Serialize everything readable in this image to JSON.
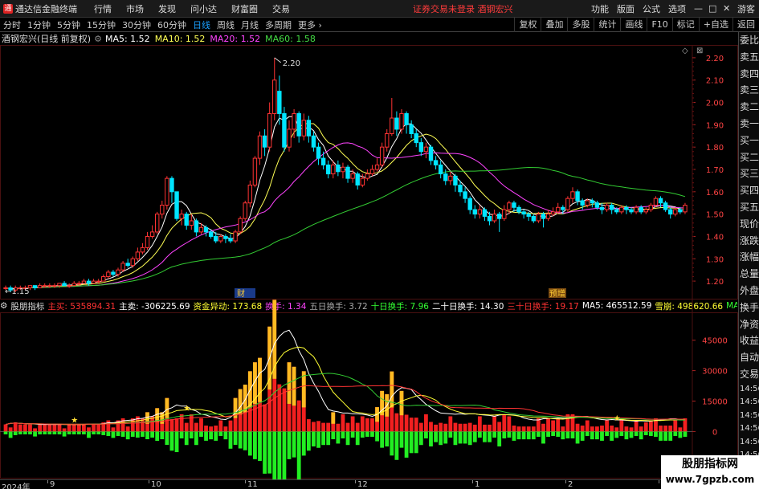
{
  "app": {
    "title": "通达信金融终端"
  },
  "menu": [
    "行情",
    "市场",
    "发现",
    "问小达",
    "财富圈",
    "交易"
  ],
  "notice": "证券交易未登录  酒钢宏兴",
  "right_menu": [
    "功能",
    "版面",
    "公式",
    "选项",
    "游客"
  ],
  "periods": [
    "分时",
    "1分钟",
    "5分钟",
    "15分钟",
    "30分钟",
    "60分钟",
    "日线",
    "周线",
    "月线",
    "多周期",
    "更多"
  ],
  "active_period": "日线",
  "toolbar_right": [
    "复权",
    "叠加",
    "多股",
    "统计",
    "画线",
    "F10",
    "标记",
    "+自选",
    "返回"
  ],
  "info": {
    "stock": "酒钢宏兴(日线 前复权)",
    "ma5": "MA5: 1.52",
    "ma10": "MA10: 1.52",
    "ma20": "MA20: 1.52",
    "ma60": "MA60: 1.58"
  },
  "right_panel": [
    "委比",
    "卖五",
    "卖四",
    "卖三",
    "卖二",
    "卖一",
    "买一",
    "买二",
    "买三",
    "买四",
    "买五",
    "现价",
    "涨跌",
    "涨幅",
    "总量",
    "外盘",
    "换手",
    "净资",
    "收益"
  ],
  "right_panel_lower": [
    "自动",
    "交易",
    "14:56",
    "14:56",
    "14:56",
    "14:56",
    "14:56",
    "14:56",
    "14:56",
    "14:56",
    "14:56"
  ],
  "indicator": {
    "name": "股朋指标",
    "zhumai": "主买: 535894.31",
    "zhumai2": "主卖: -306225.69",
    "zijin": "资金异动: 173.68",
    "huanshou": "换手: 1.34",
    "wuri": "五日换手: 3.72",
    "shiri": "十日换手: 7.96",
    "ershi": "二十日换手: 14.30",
    "sanshi": "三十日换手: 19.17",
    "ma5": "MA5: 465512.59",
    "xuebeng": "雪崩: 498620.66",
    "ma21": "MA21: 447254.53"
  },
  "price_axis": [
    "2.20",
    "2.10",
    "2.00",
    "1.90",
    "1.80",
    "1.70",
    "1.60",
    "1.50",
    "1.40",
    "1.30",
    "1.20"
  ],
  "vol_axis": [
    "45000",
    "30000",
    "15000",
    "0",
    "-15000"
  ],
  "annotations": {
    "high": "2.20",
    "low": "1.15",
    "event1": "财",
    "event2": "预增"
  },
  "dates": [
    "2024年",
    "9",
    "10",
    "11",
    "12",
    "1",
    "2",
    "3"
  ],
  "watermark": {
    "line1": "股朋指标网",
    "line2": "www.7gpzb.com"
  },
  "chart_data": {
    "type": "candlestick",
    "price_range": [
      1.15,
      2.25
    ],
    "candles": [
      [
        1.17,
        1.17,
        1.18,
        1.16
      ],
      [
        1.17,
        1.16,
        1.18,
        1.15
      ],
      [
        1.16,
        1.17,
        1.18,
        1.15
      ],
      [
        1.17,
        1.17,
        1.18,
        1.16
      ],
      [
        1.17,
        1.17,
        1.18,
        1.16
      ],
      [
        1.17,
        1.18,
        1.18,
        1.16
      ],
      [
        1.18,
        1.17,
        1.18,
        1.16
      ],
      [
        1.17,
        1.18,
        1.19,
        1.17
      ],
      [
        1.18,
        1.18,
        1.19,
        1.17
      ],
      [
        1.18,
        1.18,
        1.19,
        1.17
      ],
      [
        1.18,
        1.18,
        1.19,
        1.17
      ],
      [
        1.18,
        1.19,
        1.19,
        1.17
      ],
      [
        1.19,
        1.18,
        1.2,
        1.18
      ],
      [
        1.18,
        1.18,
        1.19,
        1.17
      ],
      [
        1.18,
        1.19,
        1.2,
        1.18
      ],
      [
        1.19,
        1.19,
        1.2,
        1.18
      ],
      [
        1.19,
        1.2,
        1.21,
        1.19
      ],
      [
        1.2,
        1.19,
        1.21,
        1.18
      ],
      [
        1.19,
        1.2,
        1.21,
        1.19
      ],
      [
        1.2,
        1.2,
        1.21,
        1.19
      ],
      [
        1.2,
        1.22,
        1.23,
        1.2
      ],
      [
        1.22,
        1.24,
        1.25,
        1.21
      ],
      [
        1.24,
        1.23,
        1.25,
        1.22
      ],
      [
        1.23,
        1.25,
        1.26,
        1.22
      ],
      [
        1.25,
        1.28,
        1.29,
        1.24
      ],
      [
        1.28,
        1.27,
        1.3,
        1.26
      ],
      [
        1.27,
        1.3,
        1.31,
        1.26
      ],
      [
        1.3,
        1.33,
        1.35,
        1.29
      ],
      [
        1.33,
        1.35,
        1.37,
        1.32
      ],
      [
        1.35,
        1.4,
        1.42,
        1.34
      ],
      [
        1.4,
        1.42,
        1.45,
        1.39
      ],
      [
        1.42,
        1.5,
        1.51,
        1.41
      ],
      [
        1.5,
        1.54,
        1.56,
        1.48
      ],
      [
        1.54,
        1.66,
        1.67,
        1.52
      ],
      [
        1.66,
        1.6,
        1.67,
        1.55
      ],
      [
        1.6,
        1.48,
        1.6,
        1.47
      ],
      [
        1.48,
        1.5,
        1.52,
        1.45
      ],
      [
        1.5,
        1.45,
        1.51,
        1.43
      ],
      [
        1.45,
        1.47,
        1.5,
        1.43
      ],
      [
        1.47,
        1.42,
        1.48,
        1.4
      ],
      [
        1.42,
        1.44,
        1.46,
        1.41
      ],
      [
        1.44,
        1.42,
        1.45,
        1.4
      ],
      [
        1.42,
        1.4,
        1.43,
        1.39
      ],
      [
        1.4,
        1.38,
        1.42,
        1.37
      ],
      [
        1.38,
        1.4,
        1.41,
        1.37
      ],
      [
        1.4,
        1.39,
        1.41,
        1.37
      ],
      [
        1.39,
        1.38,
        1.41,
        1.37
      ],
      [
        1.38,
        1.42,
        1.43,
        1.37
      ],
      [
        1.42,
        1.48,
        1.49,
        1.41
      ],
      [
        1.48,
        1.55,
        1.56,
        1.47
      ],
      [
        1.55,
        1.63,
        1.65,
        1.53
      ],
      [
        1.63,
        1.75,
        1.76,
        1.62
      ],
      [
        1.75,
        1.85,
        1.87,
        1.72
      ],
      [
        1.85,
        1.8,
        1.88,
        1.76
      ],
      [
        1.8,
        1.95,
        2.0,
        1.78
      ],
      [
        1.95,
        2.1,
        2.2,
        1.92
      ],
      [
        2.05,
        1.95,
        2.12,
        1.9
      ],
      [
        1.95,
        1.8,
        1.98,
        1.78
      ],
      [
        1.8,
        1.88,
        1.92,
        1.78
      ],
      [
        1.88,
        1.95,
        1.97,
        1.84
      ],
      [
        1.95,
        1.85,
        1.96,
        1.82
      ],
      [
        1.85,
        1.92,
        1.95,
        1.83
      ],
      [
        1.92,
        1.85,
        1.94,
        1.82
      ],
      [
        1.85,
        1.8,
        1.87,
        1.78
      ],
      [
        1.8,
        1.75,
        1.82,
        1.72
      ],
      [
        1.75,
        1.72,
        1.78,
        1.7
      ],
      [
        1.72,
        1.68,
        1.74,
        1.66
      ],
      [
        1.68,
        1.72,
        1.74,
        1.66
      ],
      [
        1.72,
        1.69,
        1.74,
        1.67
      ],
      [
        1.69,
        1.71,
        1.73,
        1.66
      ],
      [
        1.71,
        1.66,
        1.72,
        1.64
      ],
      [
        1.66,
        1.68,
        1.7,
        1.64
      ],
      [
        1.68,
        1.63,
        1.69,
        1.61
      ],
      [
        1.63,
        1.66,
        1.68,
        1.62
      ],
      [
        1.66,
        1.68,
        1.7,
        1.65
      ],
      [
        1.68,
        1.7,
        1.72,
        1.67
      ],
      [
        1.7,
        1.72,
        1.75,
        1.69
      ],
      [
        1.72,
        1.8,
        1.82,
        1.71
      ],
      [
        1.8,
        1.86,
        1.88,
        1.78
      ],
      [
        1.86,
        1.93,
        2.02,
        1.85
      ],
      [
        1.93,
        1.88,
        1.96,
        1.85
      ],
      [
        1.88,
        1.95,
        1.97,
        1.86
      ],
      [
        1.95,
        1.9,
        1.96,
        1.86
      ],
      [
        1.9,
        1.86,
        1.92,
        1.84
      ],
      [
        1.86,
        1.82,
        1.88,
        1.8
      ],
      [
        1.82,
        1.78,
        1.84,
        1.76
      ],
      [
        1.78,
        1.8,
        1.82,
        1.75
      ],
      [
        1.8,
        1.74,
        1.81,
        1.72
      ],
      [
        1.74,
        1.72,
        1.76,
        1.7
      ],
      [
        1.72,
        1.68,
        1.74,
        1.66
      ],
      [
        1.68,
        1.65,
        1.7,
        1.63
      ],
      [
        1.65,
        1.67,
        1.69,
        1.63
      ],
      [
        1.67,
        1.63,
        1.68,
        1.6
      ],
      [
        1.63,
        1.6,
        1.65,
        1.58
      ],
      [
        1.6,
        1.57,
        1.62,
        1.55
      ],
      [
        1.57,
        1.52,
        1.58,
        1.5
      ],
      [
        1.52,
        1.5,
        1.54,
        1.48
      ],
      [
        1.5,
        1.52,
        1.54,
        1.48
      ],
      [
        1.52,
        1.49,
        1.53,
        1.47
      ],
      [
        1.49,
        1.47,
        1.51,
        1.45
      ],
      [
        1.47,
        1.5,
        1.52,
        1.46
      ],
      [
        1.5,
        1.48,
        1.51,
        1.42
      ],
      [
        1.48,
        1.52,
        1.54,
        1.47
      ],
      [
        1.52,
        1.55,
        1.56,
        1.5
      ],
      [
        1.55,
        1.53,
        1.56,
        1.51
      ],
      [
        1.53,
        1.51,
        1.54,
        1.5
      ],
      [
        1.51,
        1.5,
        1.52,
        1.48
      ],
      [
        1.5,
        1.49,
        1.51,
        1.47
      ],
      [
        1.49,
        1.47,
        1.5,
        1.46
      ],
      [
        1.47,
        1.5,
        1.51,
        1.46
      ],
      [
        1.5,
        1.48,
        1.51,
        1.44
      ],
      [
        1.48,
        1.5,
        1.52,
        1.47
      ],
      [
        1.5,
        1.51,
        1.53,
        1.49
      ],
      [
        1.51,
        1.53,
        1.55,
        1.5
      ],
      [
        1.53,
        1.52,
        1.54,
        1.5
      ],
      [
        1.52,
        1.57,
        1.58,
        1.51
      ],
      [
        1.57,
        1.6,
        1.62,
        1.55
      ],
      [
        1.6,
        1.56,
        1.61,
        1.54
      ],
      [
        1.56,
        1.54,
        1.57,
        1.52
      ],
      [
        1.54,
        1.56,
        1.57,
        1.53
      ],
      [
        1.56,
        1.55,
        1.57,
        1.53
      ],
      [
        1.55,
        1.53,
        1.56,
        1.52
      ],
      [
        1.53,
        1.52,
        1.55,
        1.5
      ],
      [
        1.52,
        1.54,
        1.55,
        1.51
      ],
      [
        1.54,
        1.52,
        1.55,
        1.5
      ],
      [
        1.52,
        1.51,
        1.53,
        1.5
      ],
      [
        1.51,
        1.53,
        1.54,
        1.5
      ],
      [
        1.53,
        1.52,
        1.54,
        1.5
      ],
      [
        1.52,
        1.51,
        1.53,
        1.5
      ],
      [
        1.51,
        1.53,
        1.54,
        1.5
      ],
      [
        1.53,
        1.51,
        1.54,
        1.5
      ],
      [
        1.51,
        1.52,
        1.53,
        1.5
      ],
      [
        1.52,
        1.54,
        1.55,
        1.51
      ],
      [
        1.54,
        1.57,
        1.58,
        1.53
      ],
      [
        1.57,
        1.55,
        1.58,
        1.53
      ],
      [
        1.55,
        1.52,
        1.56,
        1.51
      ],
      [
        1.52,
        1.5,
        1.53,
        1.48
      ],
      [
        1.5,
        1.52,
        1.53,
        1.49
      ],
      [
        1.52,
        1.51,
        1.53,
        1.5
      ],
      [
        1.51,
        1.54,
        1.55,
        1.5
      ]
    ]
  }
}
